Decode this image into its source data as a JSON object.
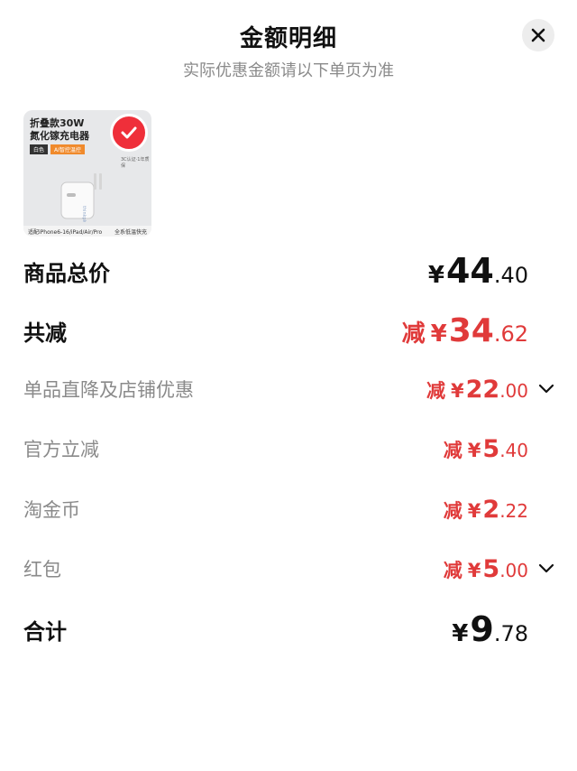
{
  "header": {
    "title": "金额明细",
    "subtitle": "实际优惠金额请以下单页为准"
  },
  "product": {
    "title_line1": "折叠款30W",
    "title_line2": "氮化镓充电器",
    "tag1": "白色",
    "tag2": "AI智控温控",
    "brand": "thinkplus",
    "note": "3C认证·1年质保",
    "bottom_left": "适配iPhone6-16/iPad/Air/Pro",
    "bottom_right": "全系低温快充"
  },
  "rows": {
    "total_price": {
      "label": "商品总价",
      "currency": "¥",
      "int": "44",
      "dec": ".40"
    },
    "total_reduce": {
      "label": "共减",
      "prefix": "减",
      "currency": "¥",
      "int": "34",
      "dec": ".62"
    },
    "store_discount": {
      "label": "单品直降及店铺优惠",
      "prefix": "减",
      "currency": "¥",
      "int": "22",
      "dec": ".00"
    },
    "official_reduce": {
      "label": "官方立减",
      "prefix": "减",
      "currency": "¥",
      "int": "5",
      "dec": ".40"
    },
    "taojinbi": {
      "label": "淘金币",
      "prefix": "减",
      "currency": "¥",
      "int": "2",
      "dec": ".22"
    },
    "red_packet": {
      "label": "红包",
      "prefix": "减",
      "currency": "¥",
      "int": "5",
      "dec": ".00"
    },
    "sum": {
      "label": "合计",
      "currency": "¥",
      "int": "9",
      "dec": ".78"
    }
  },
  "colors": {
    "accent_red": "#e03a3a",
    "text_gray": "#8a8a8a",
    "close_bg": "#ededed"
  },
  "icons": {
    "close": "close-icon",
    "expand": "chevron-down-icon",
    "check": "check-icon"
  }
}
